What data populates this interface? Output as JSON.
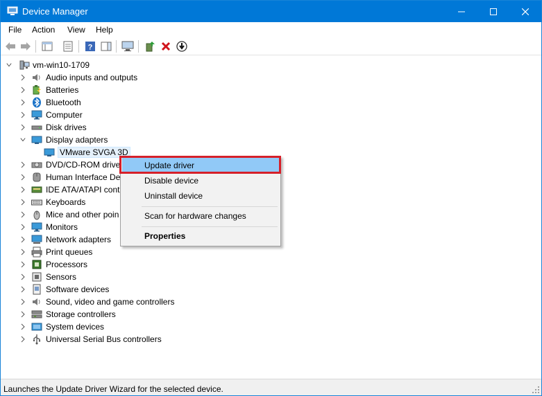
{
  "window": {
    "title": "Device Manager"
  },
  "menubar": {
    "file": "File",
    "action": "Action",
    "view": "View",
    "help": "Help"
  },
  "toolbar": {
    "icons": [
      "back-arrow-icon",
      "forward-arrow-icon",
      "console-tree-icon",
      "properties-sheet-icon",
      "help-icon",
      "action-pane-icon",
      "monitor-scan-icon",
      "add-driver-icon",
      "uninstall-x-icon",
      "download-arrow-icon"
    ]
  },
  "tree": {
    "root": "vm-win10-1709",
    "categories": [
      {
        "label": "Audio inputs and outputs",
        "icon": "speaker-icon"
      },
      {
        "label": "Batteries",
        "icon": "battery-icon"
      },
      {
        "label": "Bluetooth",
        "icon": "bluetooth-icon"
      },
      {
        "label": "Computer",
        "icon": "computer-icon"
      },
      {
        "label": "Disk drives",
        "icon": "disk-drive-icon"
      },
      {
        "label": "Display adapters",
        "icon": "display-adapter-icon",
        "expanded": true
      },
      {
        "label": "DVD/CD-ROM drive",
        "icon": "dvd-icon"
      },
      {
        "label": "Human Interface De",
        "icon": "hid-icon"
      },
      {
        "label": "IDE ATA/ATAPI cont",
        "icon": "ide-icon"
      },
      {
        "label": "Keyboards",
        "icon": "keyboard-icon"
      },
      {
        "label": "Mice and other poin",
        "icon": "mouse-icon"
      },
      {
        "label": "Monitors",
        "icon": "monitor-icon"
      },
      {
        "label": "Network adapters",
        "icon": "network-icon"
      },
      {
        "label": "Print queues",
        "icon": "printer-icon"
      },
      {
        "label": "Processors",
        "icon": "processor-icon"
      },
      {
        "label": "Sensors",
        "icon": "sensor-icon"
      },
      {
        "label": "Software devices",
        "icon": "software-device-icon"
      },
      {
        "label": "Sound, video and game controllers",
        "icon": "sound-icon"
      },
      {
        "label": "Storage controllers",
        "icon": "storage-icon"
      },
      {
        "label": "System devices",
        "icon": "system-device-icon"
      },
      {
        "label": "Universal Serial Bus controllers",
        "icon": "usb-icon"
      }
    ],
    "display_child": "VMware SVGA 3D"
  },
  "context_menu": {
    "update_driver": "Update driver",
    "disable_device": "Disable device",
    "uninstall_device": "Uninstall device",
    "scan": "Scan for hardware changes",
    "properties": "Properties"
  },
  "statusbar": {
    "text": "Launches the Update Driver Wizard for the selected device."
  },
  "colors": {
    "titlebar": "#0078d7",
    "menu_highlight": "#91c9f7",
    "highlight_box": "#d6202a"
  }
}
